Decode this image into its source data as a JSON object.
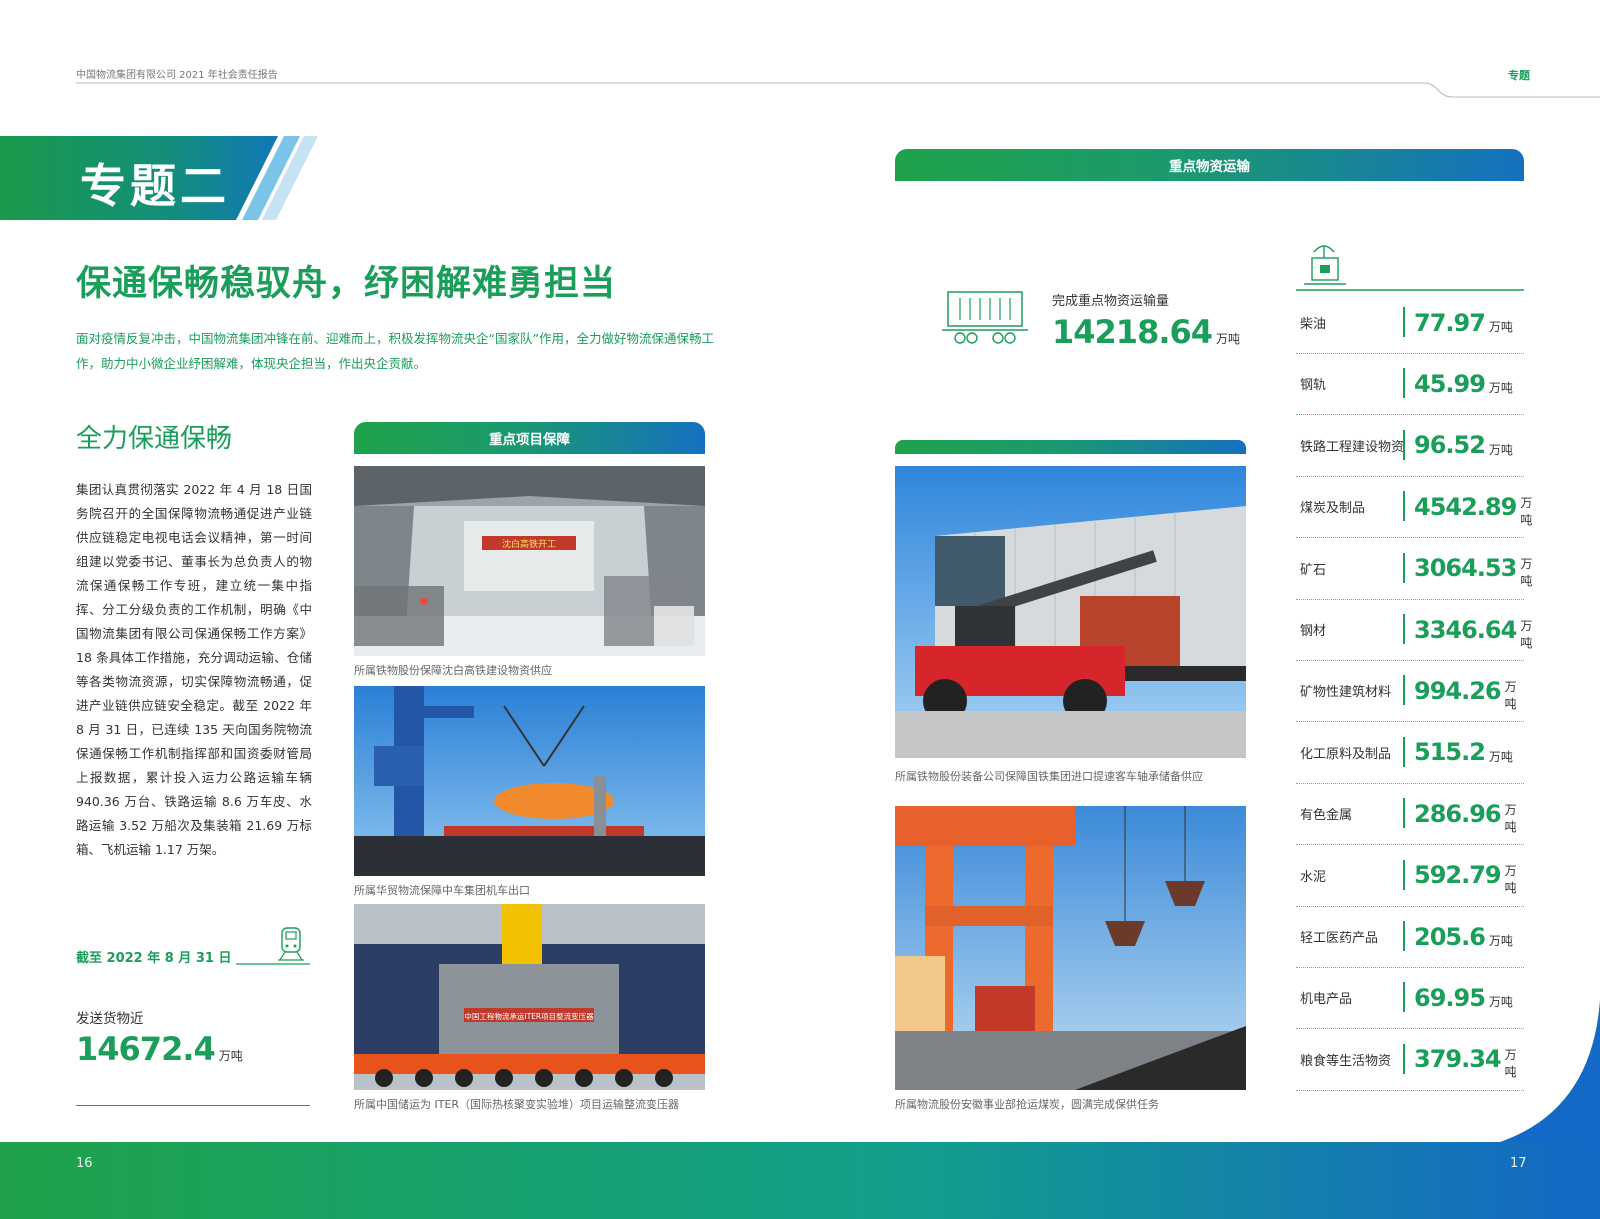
{
  "header": {
    "report_title": "中国物流集团有限公司 2021 年社会责任报告",
    "section_tag": "专题"
  },
  "banner": {
    "title": "专题二"
  },
  "main_title": "保通保畅稳驭舟，纾困解难勇担当",
  "intro": "面对疫情反复冲击，中国物流集团冲锋在前、迎难而上，积极发挥物流央企“国家队”作用，全力做好物流保通保畅工作，助力中小微企业纾困解难，体现央企担当，作出央企贡献。",
  "section1": {
    "title": "全力保通保畅",
    "body": "集团认真贯彻落实 2022 年 4 月 18 日国务院召开的全国保障物流畅通促进产业链供应链稳定电视电话会议精神，第一时间组建以党委书记、董事长为总负责人的物流保通保畅工作专班，建立统一集中指挥、分工分级负责的工作机制，明确《中国物流集团有限公司保通保畅工作方案》18 条具体工作措施，充分调动运输、仓储等各类物流资源，切实保障物流畅通，促进产业链供应链安全稳定。截至 2022 年 8 月 31 日，已连续 135 天向国务院物流保通保畅工作机制指挥部和国资委财管局上报数据，累计投入运力公路运输车辆 940.36 万台、铁路运输 8.6 万车皮、水路运输 3.52 万船次及集装箱 21.69 万标箱、飞机运输 1.17 万架。"
  },
  "stats": {
    "date_label": "截至 2022 年 8 月 31 日",
    "label": "发送货物近",
    "value": "14672.4",
    "unit": "万吨"
  },
  "project_panel": {
    "tab": "重点项目保障",
    "captions": [
      "所属铁物股份保障沈白高铁建设物资供应",
      "所属华贸物流保障中车集团机车出口",
      "所属中国储运为 ITER（国际热核聚变实验堆）项目运输整流变压器"
    ],
    "photo1_banner": "沈白高铁开工",
    "photo3_banner": "中国工程物流承运ITER项目整流变压器"
  },
  "right_photos": {
    "captions": [
      "所属铁物股份装备公司保障国铁集团进口提速客车轴承储备供应",
      "所属物流股份安徽事业部抢运煤炭，圆满完成保供任务"
    ]
  },
  "material_panel": {
    "tab": "重点物资运输",
    "total_label": "完成重点物资运输量",
    "total_value": "14218.64",
    "total_unit": "万吨",
    "items": [
      {
        "name": "柴油",
        "value": "77.97",
        "unit": "万吨"
      },
      {
        "name": "钢轨",
        "value": "45.99",
        "unit": "万吨"
      },
      {
        "name": "铁路工程建设物资",
        "value": "96.52",
        "unit": "万吨"
      },
      {
        "name": "煤炭及制品",
        "value": "4542.89",
        "unit": "万吨"
      },
      {
        "name": "矿石",
        "value": "3064.53",
        "unit": "万吨"
      },
      {
        "name": "钢材",
        "value": "3346.64",
        "unit": "万吨"
      },
      {
        "name": "矿物性建筑材料",
        "value": "994.26",
        "unit": "万吨"
      },
      {
        "name": "化工原料及制品",
        "value": "515.2",
        "unit": "万吨"
      },
      {
        "name": "有色金属",
        "value": "286.96",
        "unit": "万吨"
      },
      {
        "name": "水泥",
        "value": "592.79",
        "unit": "万吨"
      },
      {
        "name": "轻工医药产品",
        "value": "205.6",
        "unit": "万吨"
      },
      {
        "name": "机电产品",
        "value": "69.95",
        "unit": "万吨"
      },
      {
        "name": "粮食等生活物资",
        "value": "379.34",
        "unit": "万吨"
      }
    ]
  },
  "footer": {
    "page_left": "16",
    "page_right": "17"
  },
  "colors": {
    "green": "#1a9e5a",
    "blue": "#1570c0",
    "teal": "#16a58e"
  }
}
